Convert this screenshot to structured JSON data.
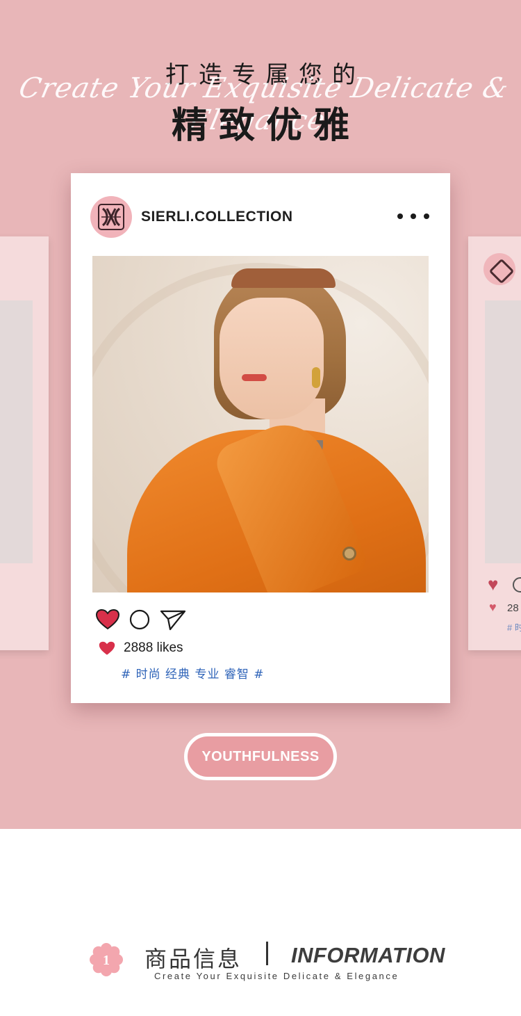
{
  "hero": {
    "title_top": "打造专属您的",
    "title_main": "精致优雅",
    "script_text": "Create Your Exquisite Delicate & Elegance"
  },
  "post": {
    "username": "SIERLI.COLLECTION",
    "likes_text": "2888 likes",
    "tags": "# 时尚 经典 专业 睿智 #"
  },
  "ghost_right": {
    "likes_fragment": "28",
    "tags_fragment": "# 时"
  },
  "badge": {
    "label": "YOUTHFULNESS"
  },
  "info": {
    "number": "1",
    "title_cn": "商品信息",
    "title_en": "INFORMATION",
    "subtitle": "Create Your Exquisite Delicate & Elegance"
  },
  "colors": {
    "hero_background": "#e8b6b8",
    "heart": "#d8304a",
    "tag_text": "#2e63b8",
    "badge_fill": "#e89da2"
  },
  "icons": [
    "heart-icon",
    "comment-icon",
    "send-icon",
    "more-icon",
    "brand-logo-icon",
    "flower-badge-icon"
  ]
}
